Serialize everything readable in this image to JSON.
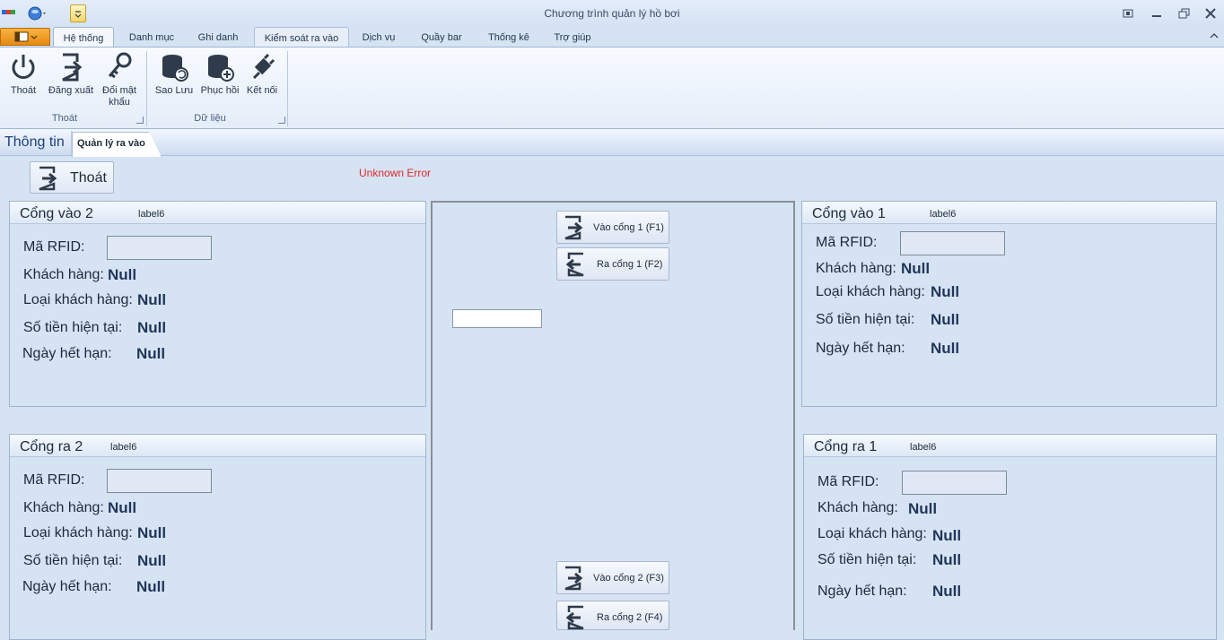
{
  "window": {
    "title": "Chương trình quản lý hồ bơi"
  },
  "ribbon_tabs": [
    "Hệ thống",
    "Danh mục",
    "Ghi danh",
    "Kiểm soát ra vào",
    "Dịch vụ",
    "Quầy bar",
    "Thống kê",
    "Trợ giúp"
  ],
  "ribbon": {
    "group1": {
      "label": "Thoát",
      "buttons": [
        "Thoát",
        "Đăng xuất",
        "Đổi mật khẩu"
      ]
    },
    "group2": {
      "label": "Dữ liệu",
      "buttons": [
        "Sao Lưu",
        "Phục hồi",
        "Kết nối"
      ]
    }
  },
  "doc_tabs": [
    "Thông tin",
    "Quản lý ra vào"
  ],
  "main": {
    "exit_button": "Thoát",
    "error": "Unknown Error",
    "center_buttons": [
      "Vào cổng 1 (F1)",
      "Ra cổng 1 (F2)",
      "Vào cổng 2 (F3)",
      "Ra cổng 2 (F4)"
    ]
  },
  "field_labels": {
    "rfid": "Mã RFID:",
    "customer": "Khách hàng:",
    "customer_type": "Loại khách hàng:",
    "balance": "Số tiền hiện tại:",
    "expiry": "Ngày hết hạn:"
  },
  "gates": [
    {
      "title": "Cổng vào 2",
      "sub": "label6",
      "customer": "Null",
      "customer_type": "Null",
      "balance": "Null",
      "expiry": "Null"
    },
    {
      "title": "Cổng ra 2",
      "sub": "label6",
      "customer": "Null",
      "customer_type": "Null",
      "balance": "Null",
      "expiry": "Null"
    },
    {
      "title": "Cổng vào 1",
      "sub": "label6",
      "customer": "Null",
      "customer_type": "Null",
      "balance": "Null",
      "expiry": "Null"
    },
    {
      "title": "Cổng ra 1",
      "sub": "label6",
      "customer": "Null",
      "customer_type": "Null",
      "balance": "Null",
      "expiry": "Null"
    }
  ],
  "colors": {
    "accent": "#1f3558",
    "error": "#e0282c",
    "background": "#d6e3f3"
  }
}
